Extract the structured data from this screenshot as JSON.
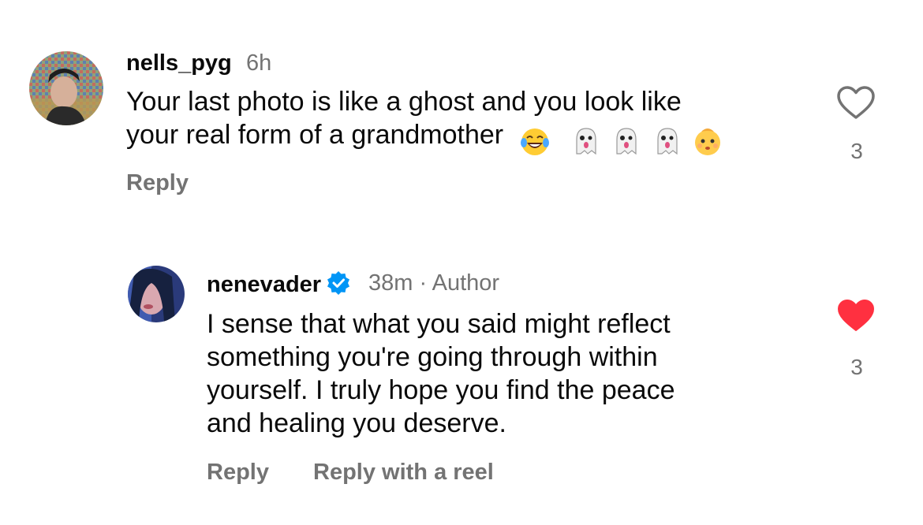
{
  "comments": [
    {
      "username": "nells_pyg",
      "time": "6h",
      "text_line1": "Your last photo is like a ghost and you look like",
      "text_line2": "your real form of a grandmother",
      "emojis": [
        "face-with-tears-of-joy-icon",
        "ghost-icon",
        "ghost-icon",
        "ghost-icon",
        "baby-face-icon"
      ],
      "reply_label": "Reply",
      "liked": false,
      "like_count": "3"
    },
    {
      "username": "nenevader",
      "verified": true,
      "time": "38m",
      "separator": "·",
      "author_label": "Author",
      "text_lines": [
        "I sense that what you said might reflect",
        "something you're going through within",
        "yourself. I truly hope you find the peace",
        "and healing you deserve."
      ],
      "reply_label": "Reply",
      "reply_reel_label": "Reply with a reel",
      "liked": true,
      "like_count": "3"
    }
  ],
  "colors": {
    "text": "#0a0a0a",
    "secondary": "#737373",
    "like_red": "#ff3040",
    "verified_blue": "#0095f6"
  }
}
